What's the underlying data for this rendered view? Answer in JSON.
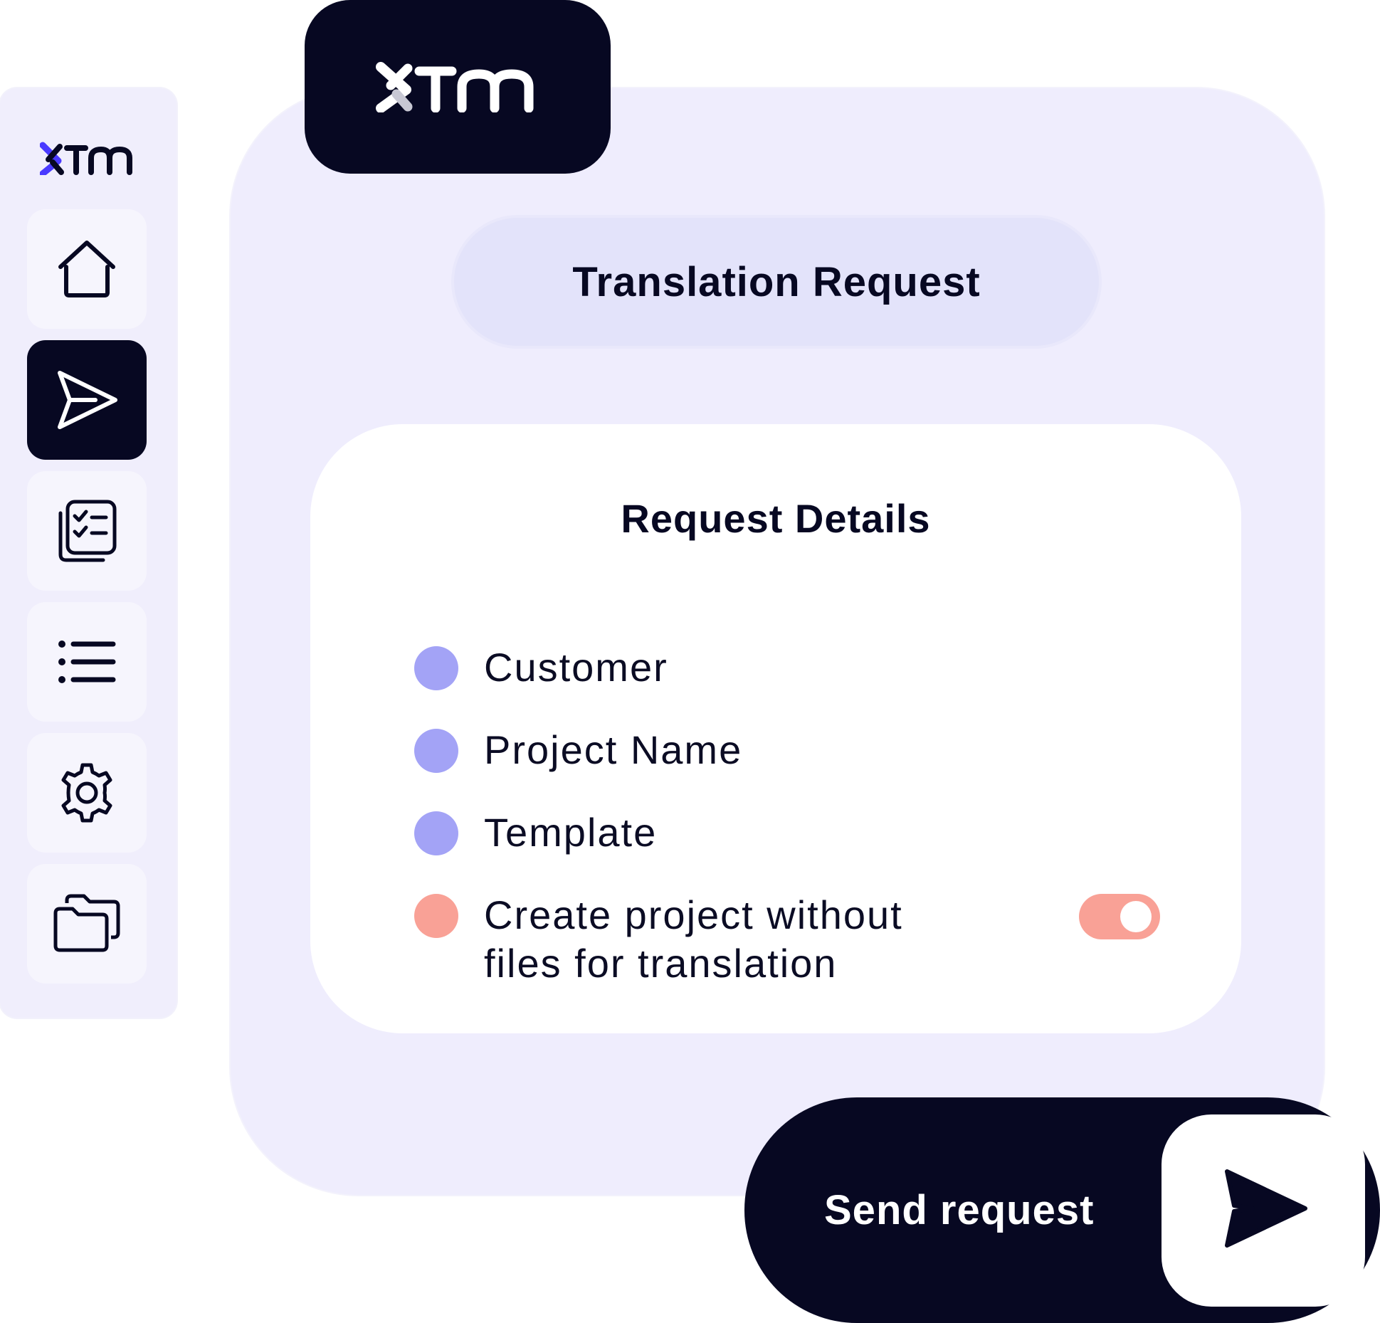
{
  "brand": {
    "name": "XTM",
    "accent_color": "#4a3aff",
    "dark_color": "#070822"
  },
  "sidebar": {
    "items": [
      {
        "icon": "home-icon",
        "active": false
      },
      {
        "icon": "send-icon",
        "active": true
      },
      {
        "icon": "checklist-icon",
        "active": false
      },
      {
        "icon": "list-icon",
        "active": false
      },
      {
        "icon": "gear-icon",
        "active": false
      },
      {
        "icon": "folder-icon",
        "active": false
      }
    ]
  },
  "header": {
    "title": "Translation Request"
  },
  "details": {
    "title": "Request Details",
    "fields": [
      {
        "label": "Customer",
        "color": "#a3a3f6"
      },
      {
        "label": "Project Name",
        "color": "#a3a3f6"
      },
      {
        "label": "Template",
        "color": "#a3a3f6"
      },
      {
        "label_line1": "Create project without",
        "label_line2": "files for translation",
        "color": "#f9a196",
        "toggle_on": true
      }
    ]
  },
  "actions": {
    "send_label": "Send request"
  }
}
